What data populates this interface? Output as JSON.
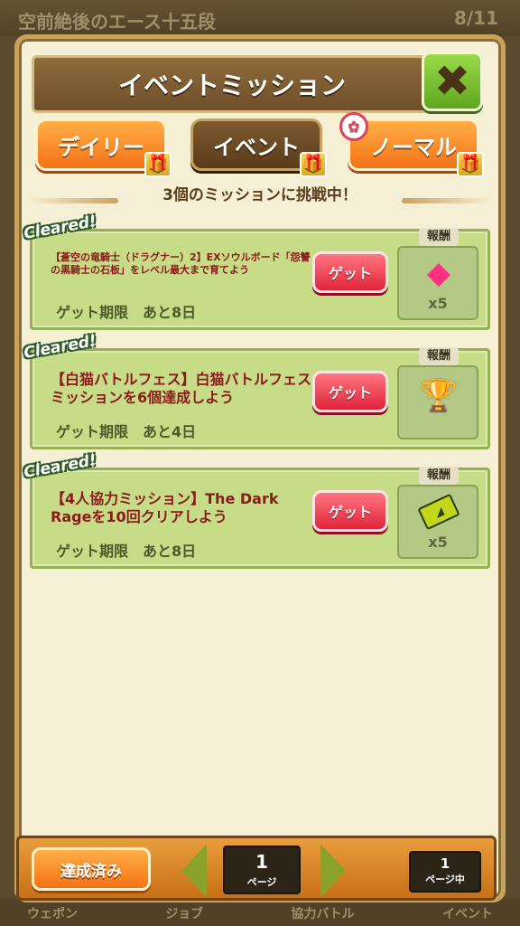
{
  "background": {
    "top_text": "空前絶後のエース十五段",
    "top_right": "8/11",
    "bottom_items": [
      "ウェポン",
      "ジョブ",
      "協力バトル",
      "イベント"
    ]
  },
  "header": {
    "title": "イベントミッション",
    "close_label": "✖"
  },
  "tabs": [
    {
      "label": "デイリー",
      "active": false
    },
    {
      "label": "イベント",
      "active": true
    },
    {
      "label": "ノーマル",
      "active": false
    }
  ],
  "status_text": "3個のミッションに挑戦中！",
  "missions": [
    {
      "cleared_label": "Cleared!",
      "description": "【蒼空の竜騎士（ドラグナー）2】EXソウルボード「怨讐の黒騎士の石板」をレベル最大まで育てよう",
      "deadline": "ゲット期限　あと8日",
      "get_label": "ゲット",
      "reward_label": "報酬",
      "reward_icon": "gem-icon",
      "reward_count": "x5"
    },
    {
      "cleared_label": "Cleared!",
      "description": "【白猫バトルフェス】白猫バトルフェスミッションを6個達成しよう",
      "deadline": "ゲット期限　あと4日",
      "get_label": "ゲット",
      "reward_label": "報酬",
      "reward_icon": "trophy-icon",
      "reward_count": ""
    },
    {
      "cleared_label": "Cleared!",
      "description": "【4人協力ミッション】The Dark Rageを10回クリアしよう",
      "deadline": "ゲット期限　あと8日",
      "get_label": "ゲット",
      "reward_label": "報酬",
      "reward_icon": "ticket-icon",
      "reward_count": "x5"
    }
  ],
  "footer": {
    "achieved_label": "達成済み",
    "page_number": "1",
    "page_label": "ページ",
    "total_number": "1",
    "total_label": "ページ中"
  },
  "colors": {
    "accent_orange": "#f47315",
    "mission_bg": "#c6dc86",
    "get_button": "#e0243a",
    "mission_text": "#8b1a1a"
  }
}
